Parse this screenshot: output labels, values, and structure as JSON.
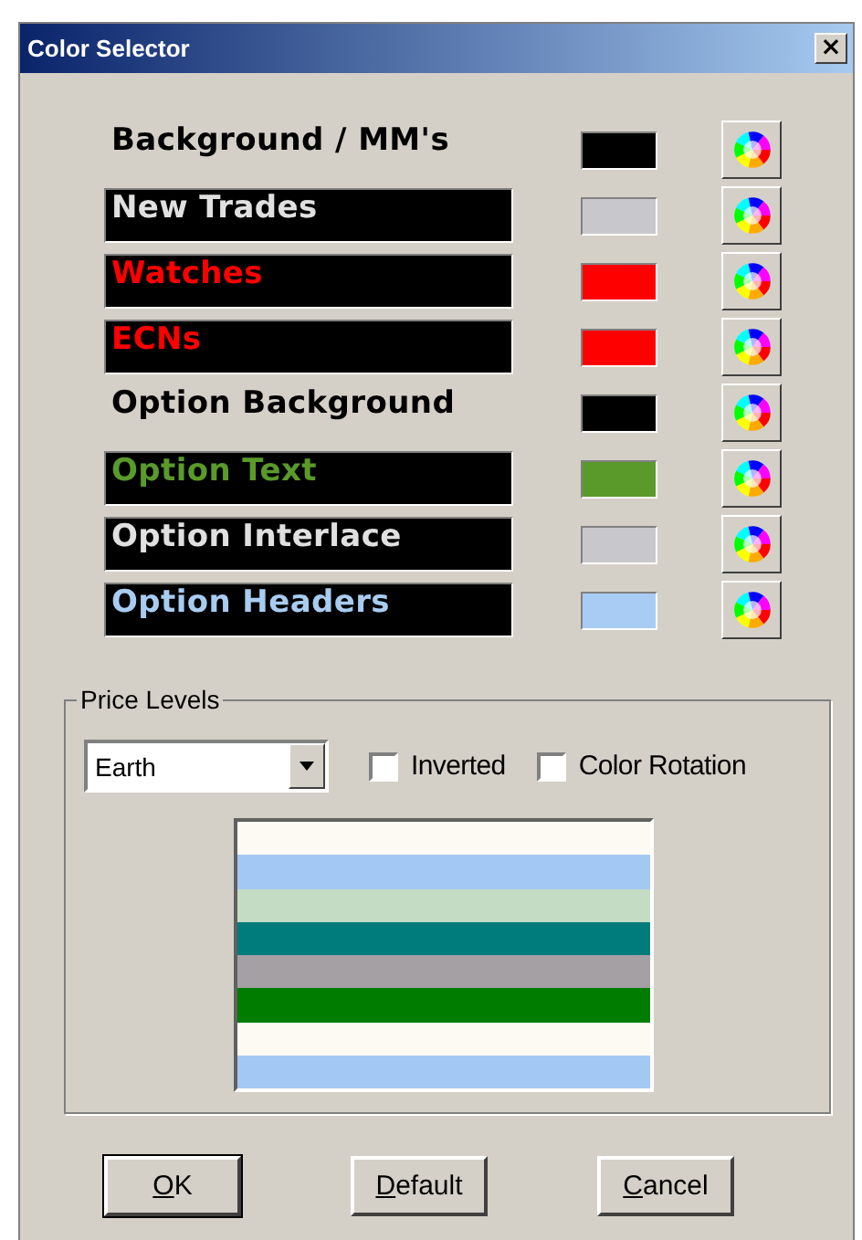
{
  "window": {
    "title": "Color Selector",
    "close": "×"
  },
  "color_items": [
    {
      "kind": "plain",
      "label": {
        "text": "Background / MM's",
        "color": "#000000"
      },
      "swatch": {
        "color": "#000000"
      }
    },
    {
      "kind": "boxed",
      "label": {
        "text": "New Trades",
        "color": "#e0e0e0"
      },
      "swatch": {
        "color": "#c8c8cc"
      }
    },
    {
      "kind": "boxed",
      "label": {
        "text": "Watches",
        "color": "#ff0000"
      },
      "swatch": {
        "color": "#ff0000"
      }
    },
    {
      "kind": "boxed",
      "label": {
        "text": "ECNs",
        "color": "#ff0000"
      },
      "swatch": {
        "color": "#ff0000"
      }
    },
    {
      "kind": "plain",
      "label": {
        "text": "Option Background",
        "color": "#000000"
      },
      "swatch": {
        "color": "#000000"
      }
    },
    {
      "kind": "boxed",
      "label": {
        "text": "Option Text",
        "color": "#5a9a2a"
      },
      "swatch": {
        "color": "#5a9a2a"
      }
    },
    {
      "kind": "boxed",
      "label": {
        "text": "Option Interlace",
        "color": "#e0e0e0"
      },
      "swatch": {
        "color": "#c8c8cc"
      }
    },
    {
      "kind": "boxed",
      "label": {
        "text": "Option Headers",
        "color": "#a8ccf0"
      },
      "swatch": {
        "color": "#a8ccf4"
      }
    }
  ],
  "price_levels": {
    "title": "Price Levels",
    "scheme": {
      "value": "Earth"
    },
    "options": [
      {
        "label": "Inverted",
        "checked": false
      },
      {
        "label": "Color Rotation",
        "checked": false
      }
    ],
    "preview": [
      {
        "color": "#fdfaf4"
      },
      {
        "color": "#a4c8f4"
      },
      {
        "color": "#c4dcc4"
      },
      {
        "color": "#007c7c"
      },
      {
        "color": "#a4a0a4"
      },
      {
        "color": "#007c00"
      },
      {
        "color": "#fdfaf4"
      },
      {
        "color": "#a4c8f4"
      }
    ]
  },
  "buttons": [
    {
      "label": "OK",
      "first_letter_underlined": true,
      "default": true
    },
    {
      "label": "Default",
      "first_letter_underlined": true,
      "default": false
    },
    {
      "label": "Cancel",
      "first_letter_underlined": true,
      "default": false
    }
  ]
}
